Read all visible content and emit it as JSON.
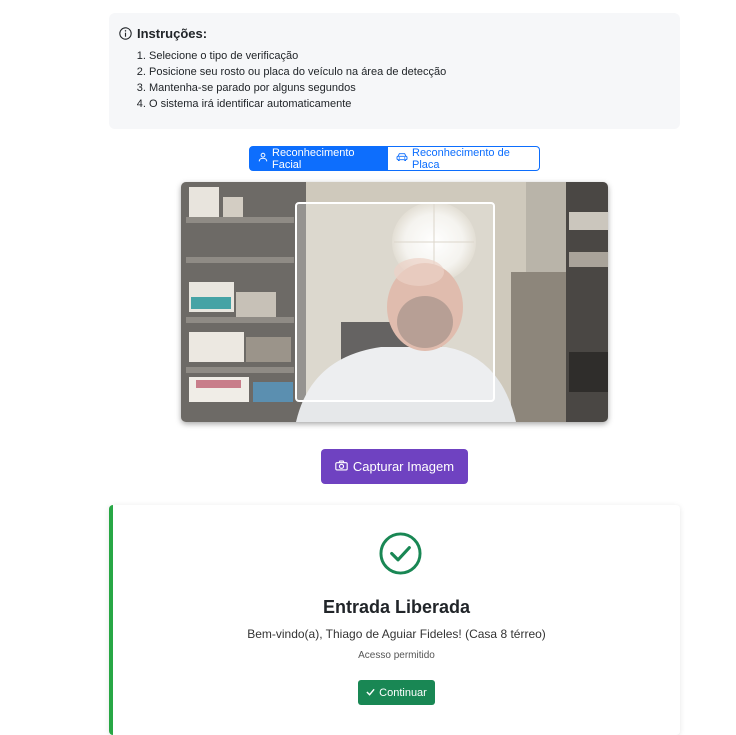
{
  "instructions": {
    "title": "Instruções:",
    "items": [
      "Selecione o tipo de verificação",
      "Posicione seu rosto ou placa do veículo na área de detecção",
      "Mantenha-se parado por alguns segundos",
      "O sistema irá identificar automaticamente"
    ],
    "icon": "info-circle-icon"
  },
  "tabs": [
    {
      "label": "Reconhecimento Facial",
      "icon": "person-icon",
      "active": true
    },
    {
      "label": "Reconhecimento de Placa",
      "icon": "car-icon",
      "active": false
    }
  ],
  "capture": {
    "label": "Capturar Imagem",
    "icon": "camera-icon"
  },
  "result": {
    "title": "Entrada Liberada",
    "welcome": "Bem-vindo(a), Thiago de Aguiar Fideles! (Casa 8 térreo)",
    "subtitle": "Acesso permitido",
    "continue_label": "Continuar",
    "icon": "check-circle-icon"
  },
  "colors": {
    "primary": "#0d6efd",
    "capture": "#6f42c1",
    "success": "#198754",
    "success_border": "#28a745"
  }
}
